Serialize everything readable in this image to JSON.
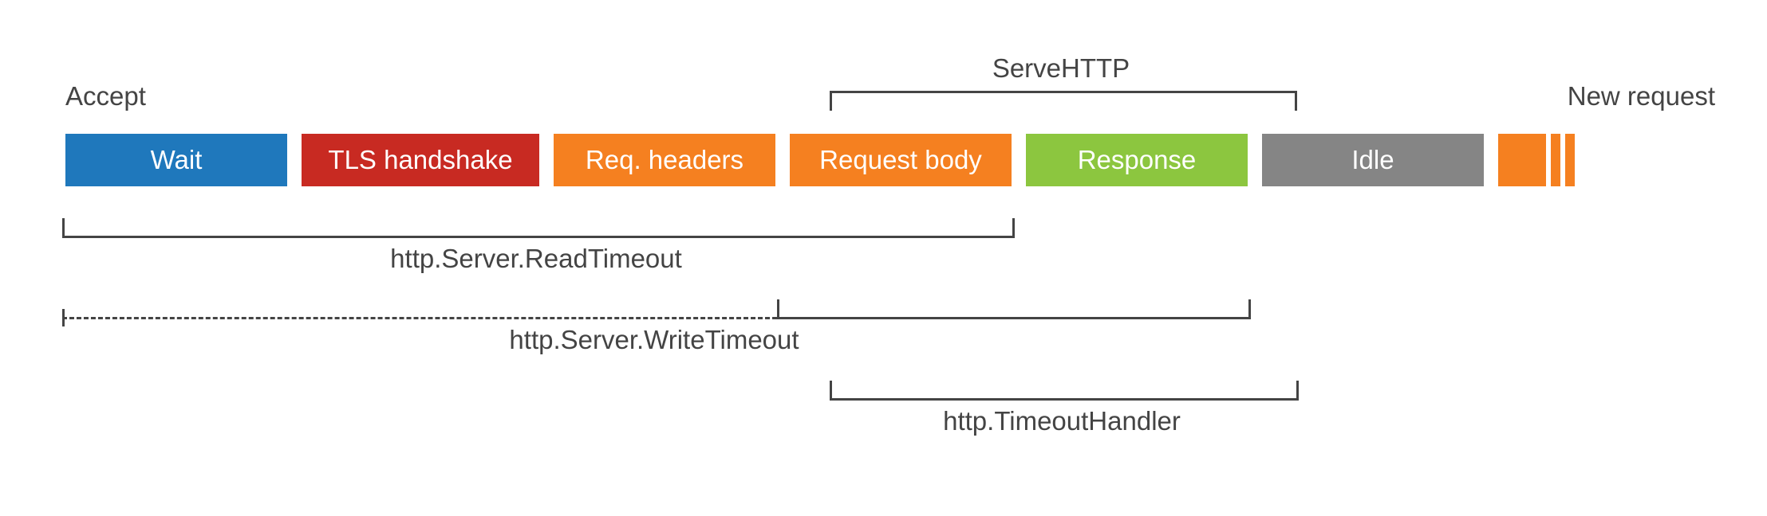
{
  "diagram": {
    "accept_label": "Accept",
    "new_request_label": "New request",
    "serve_http_label": "ServeHTTP",
    "blocks": {
      "wait": "Wait",
      "tls": "TLS handshake",
      "req_headers": "Req. headers",
      "request_body": "Request body",
      "response": "Response",
      "idle": "Idle"
    },
    "labels": {
      "read_timeout": "http.Server.ReadTimeout",
      "write_timeout": "http.Server.WriteTimeout",
      "timeout_handler": "http.TimeoutHandler"
    },
    "colors": {
      "wait": "#1f78bc",
      "tls": "#c82a22",
      "orange": "#f58020",
      "response": "#8cc63f",
      "idle": "#858585",
      "text": "#444444"
    }
  }
}
